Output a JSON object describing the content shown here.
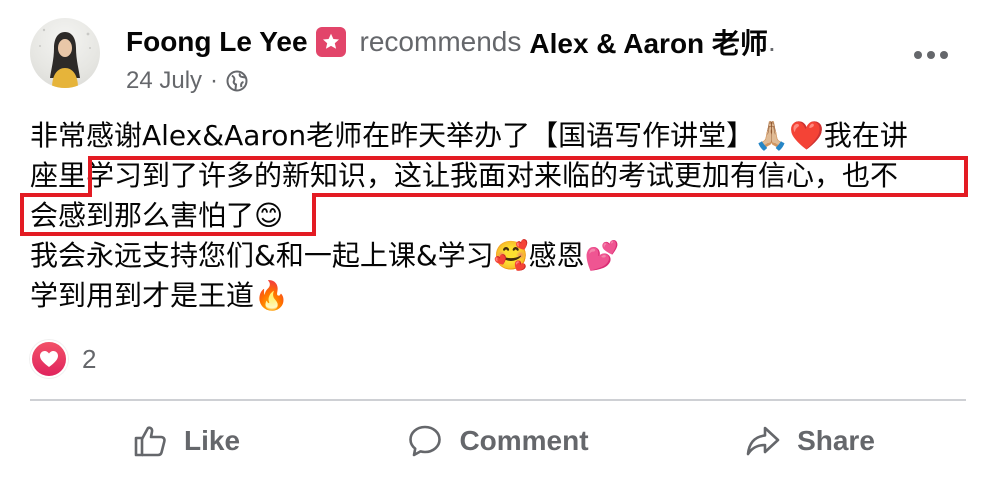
{
  "post": {
    "author": "Foong Le Yee",
    "verb": "recommends",
    "target": "Alex & Aaron 老师",
    "target_end": ".",
    "date": "24 July",
    "separator": "·",
    "lines": [
      "非常感谢Alex&Aaron老师在昨天举办了【国语写作讲堂】🙏🏼❤️我在讲",
      "座里学习到了许多的新知识，这让我面对来临的考试更加有信心，也不",
      "会感到那么害怕了😊",
      "我会永远支持您们&和一起上课&学习🥰感恩💕",
      "学到用到才是王道🔥"
    ]
  },
  "reactions": {
    "count": "2"
  },
  "actions": {
    "like": "Like",
    "comment": "Comment",
    "share": "Share"
  },
  "colors": {
    "highlight": "#e31b23",
    "badge": "#e2456a",
    "meta": "#65676b"
  },
  "icons": [
    "avatar",
    "recommend-badge-icon",
    "globe-icon",
    "more-options-icon",
    "love-reaction-icon",
    "like-icon",
    "comment-icon",
    "share-icon"
  ]
}
